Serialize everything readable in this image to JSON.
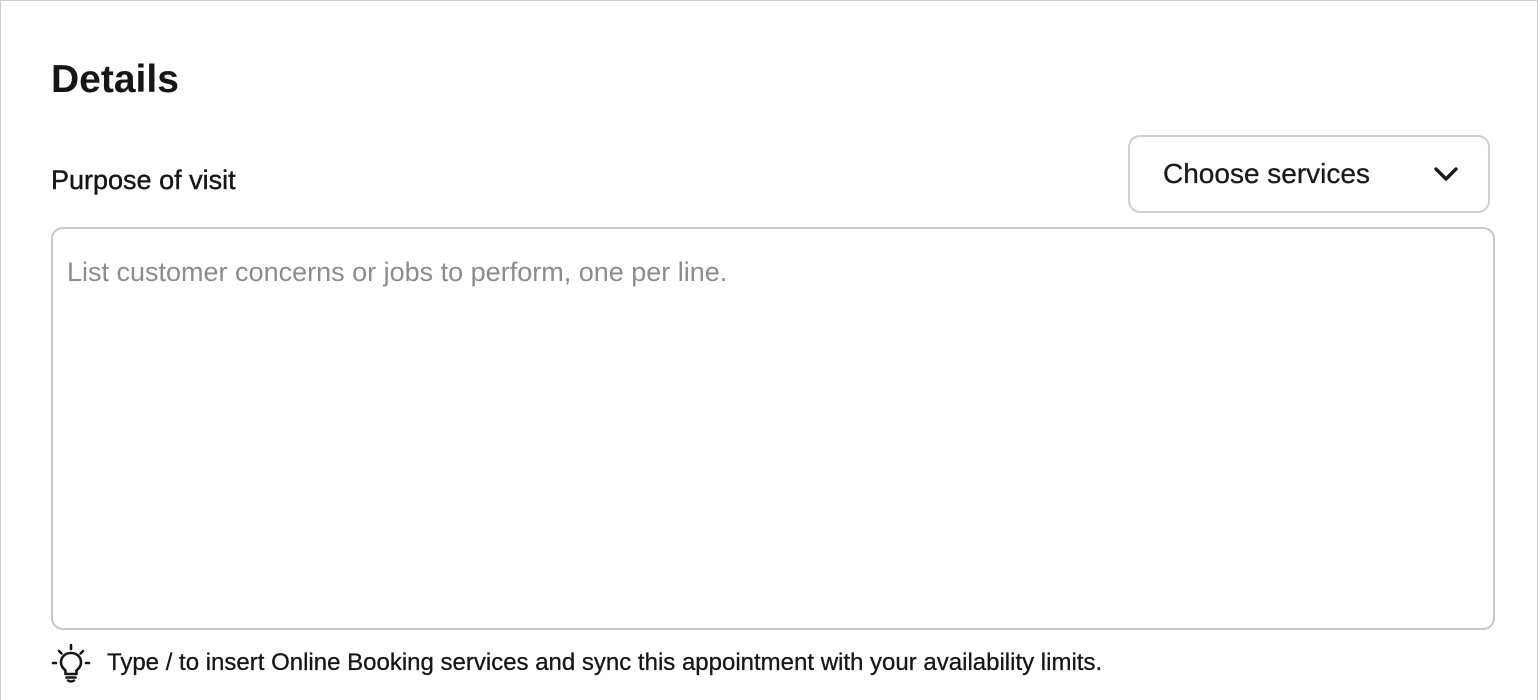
{
  "details": {
    "title": "Details",
    "purpose_label": "Purpose of visit",
    "services_select": {
      "label": "Choose services",
      "icon": "chevron-down-icon"
    },
    "purpose_textarea": {
      "value": "",
      "placeholder": "List customer concerns or jobs to perform, one per line."
    },
    "hint": {
      "icon": "lightbulb-icon",
      "text": "Type / to insert Online Booking services and sync this appointment with your availability limits."
    }
  },
  "colors": {
    "border": "#c8c8c8",
    "text": "#161616",
    "placeholder": "#8c8c8c"
  }
}
